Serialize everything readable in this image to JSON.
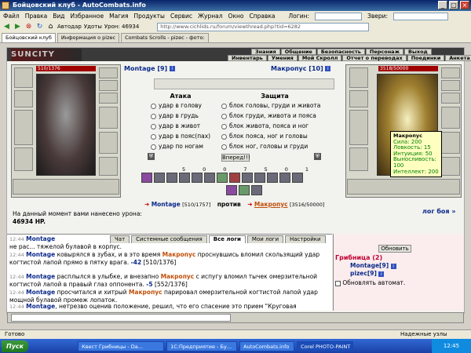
{
  "window": {
    "title": "Бойцовский клуб - AutoCombats.info"
  },
  "menu": {
    "items": [
      "Файл",
      "Правка",
      "Вид",
      "Избранное",
      "Магия",
      "Продукты",
      "Сервис",
      "Журнал",
      "Окно",
      "Справка"
    ],
    "login_label": "Логин:",
    "enemy_label": "Звери:"
  },
  "toolbar": {
    "autodar": "Автодар",
    "attacks": "Удоты",
    "damage": "Урон: 46934",
    "address": "http://www.cichlids.ru/forum/viewthread.php?tid=6282"
  },
  "browser_tabs": [
    "Бойцовский клуб",
    "Информация о pizec",
    "Combats Scrolls - pizec - фото:"
  ],
  "game": {
    "logo": "SUNCITY",
    "menu_top": [
      "Знания",
      "Общение",
      "Безопасность",
      "Персонаж",
      "Выход"
    ],
    "menu_bottom": [
      "Инвентарь",
      "Умения",
      "Мой Скролл",
      "Отчет о переводах",
      "Поединки",
      "Анкета"
    ],
    "player": {
      "name": "Montage [9]",
      "hp": "510/1376"
    },
    "enemy": {
      "name": "Макропус [10]",
      "hp": "3518/50000"
    },
    "attack_header": "Атака",
    "defense_header": "Защита",
    "attacks": [
      "удар в голову",
      "удар в грудь",
      "удар в живот",
      "удар в пояс(пах)",
      "удар по ногам"
    ],
    "defenses": [
      "блок головы, груди и живота",
      "блок груди, живота и пояса",
      "блок живота, пояса и ног",
      "блок пояса, ног и головы",
      "блок ног, головы и груди"
    ],
    "go_button": "Вперед!!!",
    "counters": [
      "5",
      "0",
      "0",
      "7",
      "5",
      "0",
      "1"
    ],
    "tooltip": {
      "name": "Макропус",
      "lines": [
        "Сила: 200",
        "Ловкость: 15",
        "Интуиция: 50",
        "Выносливость: 100",
        "Интеллект: 200"
      ]
    },
    "vs": {
      "left": "Montage",
      "left_hp": "[510/1757]",
      "mid": "против",
      "right": "Макропус",
      "right_hp": "[3516/50000]"
    },
    "damage_text": "На данный момент вами нанесено урона:",
    "damage_value": "46934 HP.",
    "battle_log_link": "лог боя »",
    "log_tabs": [
      "Чат",
      "Системные сообщения",
      "Все логи",
      "Мои логи",
      "Настройки"
    ],
    "log": [
      {
        "time": "12:44",
        "a": "Montage",
        "text": "не рас... тяжелой булавой в корпус."
      },
      {
        "time": "12:44",
        "a": "Montage",
        "text": "ковырялся в зубах, и в это время",
        "b": "Макропус",
        "text2": "проснувшись вломил скользящий удар когтистой лапой прямо в пятку врага.",
        "dmg": "-42",
        "hp": "[510/1376]"
      },
      {
        "time": "12:44",
        "a": "Montage",
        "text": "расплылся в улыбке, и внезапно",
        "b": "Макропус",
        "text2": "с испугу вломил тычек омерзительной когтистой лапой в правый глаз оппонента.",
        "dmg": "-5",
        "hp": "[552/1376]"
      },
      {
        "time": "12:44",
        "a": "Montage",
        "text": "просчитался и хитрый",
        "b": "Макропус",
        "text2": "парировал омерзительной когтистой лапой удар мощной булавой промеж лопаток."
      },
      {
        "time": "12:44",
        "a": "Montage",
        "text": ", нетрезво оценив положение, решил, что его спасение это прием \"Круговая"
      }
    ],
    "refresh_button": "Обновить",
    "room": {
      "title": "Грибница (2)",
      "members": [
        "Montage[9]",
        "pizec[9]"
      ],
      "auto_refresh": "Обновлять автомат."
    }
  },
  "statusbar": {
    "text": "Готово",
    "zone": "Надежные узлы"
  },
  "taskbar": {
    "start": "Пуск",
    "tasks": [
      "Квест Грибницы - Da...",
      "1С:Предприятие - Бу...",
      "AutoCombats.info",
      "Corel PHOTO-PAINT"
    ],
    "clock": "12:45"
  }
}
